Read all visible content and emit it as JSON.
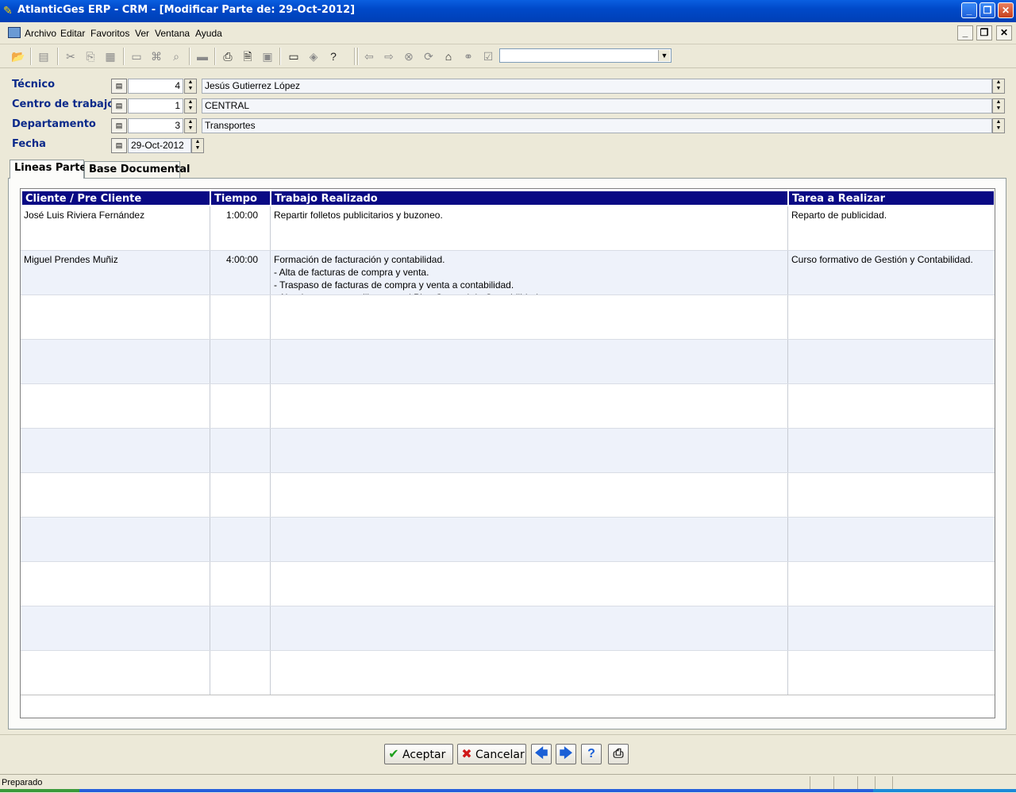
{
  "window": {
    "title": "AtlanticGes ERP - CRM - [Modificar Parte de: 29-Oct-2012]",
    "min_label": "_",
    "max_label": "❐",
    "close_label": "✕"
  },
  "menu": {
    "items": [
      "Archivo",
      "Editar",
      "Favoritos",
      "Ver",
      "Ventana",
      "Ayuda"
    ]
  },
  "toolbar": {
    "icons": [
      "open-icon",
      "edit-icon",
      "cut-icon",
      "copy-icon",
      "paste-icon",
      "window-icon",
      "find-icon",
      "search-icon",
      "scanner-icon",
      "print-icon",
      "print-preview-icon",
      "disk-icon",
      "monitor-icon",
      "diamond-icon",
      "help-icon",
      "back-icon",
      "forward-icon",
      "stop-icon",
      "refresh-icon",
      "home-icon",
      "binoculars-icon",
      "favorite-icon"
    ],
    "combo_value": ""
  },
  "form": {
    "tecnico": {
      "label": "Técnico",
      "id": "4",
      "name": "Jesús Gutierrez López"
    },
    "centro": {
      "label": "Centro de trabajo",
      "id": "1",
      "name": "CENTRAL"
    },
    "departamento": {
      "label": "Departamento",
      "id": "3",
      "name": "Transportes"
    },
    "fecha": {
      "label": "Fecha",
      "value": "29-Oct-2012"
    }
  },
  "tabs": [
    "Lineas Parte",
    "Base Documental"
  ],
  "grid": {
    "columns": [
      "Cliente / Pre Cliente",
      "Tiempo",
      "Trabajo Realizado",
      "Tarea a Realizar"
    ],
    "rows": [
      {
        "cliente": "José Luis Riviera Fernández",
        "tiempo": "1:00:00",
        "trabajo": "Repartir folletos publicitarios y buzoneo.",
        "tarea": "Reparto de publicidad."
      },
      {
        "cliente": "Miguel Prendes Muñiz",
        "tiempo": "4:00:00",
        "trabajo": "Formación de facturación y contabilidad.\n- Alta de facturas de compra y venta.\n- Traspaso de facturas de compra y venta a contabilidad.\n- Alta de cuentas auxiliares en el Plan General de Contabilidad.",
        "tarea": "Curso formativo de Gestión y Contabilidad."
      },
      {
        "cliente": "",
        "tiempo": "",
        "trabajo": "",
        "tarea": ""
      },
      {
        "cliente": "",
        "tiempo": "",
        "trabajo": "",
        "tarea": ""
      },
      {
        "cliente": "",
        "tiempo": "",
        "trabajo": "",
        "tarea": ""
      },
      {
        "cliente": "",
        "tiempo": "",
        "trabajo": "",
        "tarea": ""
      },
      {
        "cliente": "",
        "tiempo": "",
        "trabajo": "",
        "tarea": ""
      },
      {
        "cliente": "",
        "tiempo": "",
        "trabajo": "",
        "tarea": ""
      },
      {
        "cliente": "",
        "tiempo": "",
        "trabajo": "",
        "tarea": ""
      },
      {
        "cliente": "",
        "tiempo": "",
        "trabajo": "",
        "tarea": ""
      },
      {
        "cliente": "",
        "tiempo": "",
        "trabajo": "",
        "tarea": ""
      }
    ]
  },
  "buttons": {
    "accept": "Aceptar",
    "cancel": "Cancelar"
  },
  "status": {
    "text": "Preparado"
  },
  "colors": {
    "title_blue": "#0049c9",
    "header_navy": "#0a0a84",
    "label_blue": "#0b2a8a",
    "row_alt": "#eef2fa"
  }
}
